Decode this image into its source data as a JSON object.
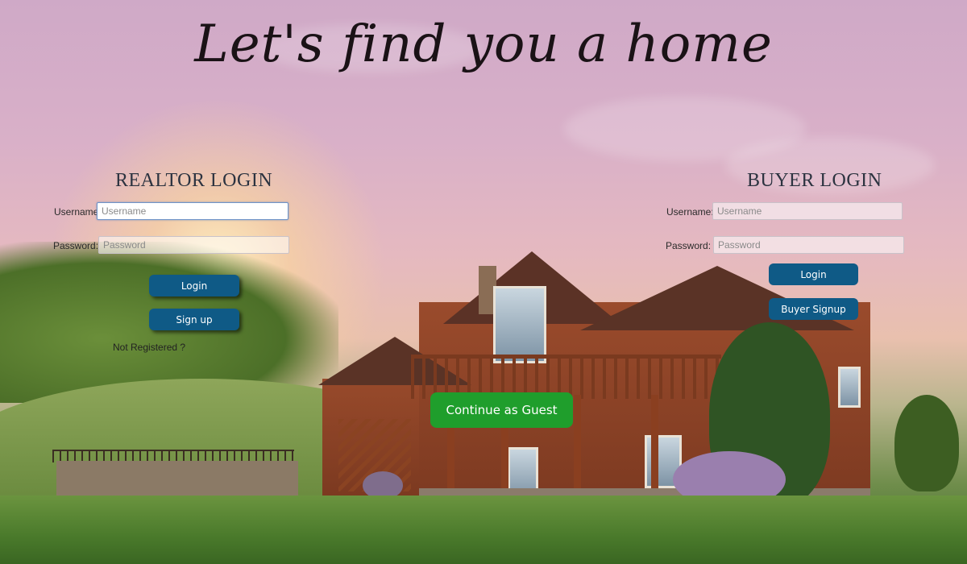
{
  "headline": "Let's find you a home",
  "realtor": {
    "title": "REALTOR LOGIN",
    "username_label": "Username:",
    "username_placeholder": "Username",
    "password_label": "Password:",
    "password_placeholder": "Password",
    "login_label": "Login",
    "signup_label": "Sign up",
    "not_registered": "Not Registered ?"
  },
  "buyer": {
    "title": "BUYER LOGIN",
    "username_label": "Username:",
    "username_placeholder": "Username",
    "password_label": "Password:",
    "password_placeholder": "Password",
    "login_label": "Login",
    "signup_label": "Buyer Signup"
  },
  "guest": {
    "label": "Continue as Guest"
  },
  "colors": {
    "primary_button": "#0f5a86",
    "guest_button": "#1f9e2c",
    "sky_top": "#cfa9c7",
    "lawn": "#4a7a2b"
  }
}
